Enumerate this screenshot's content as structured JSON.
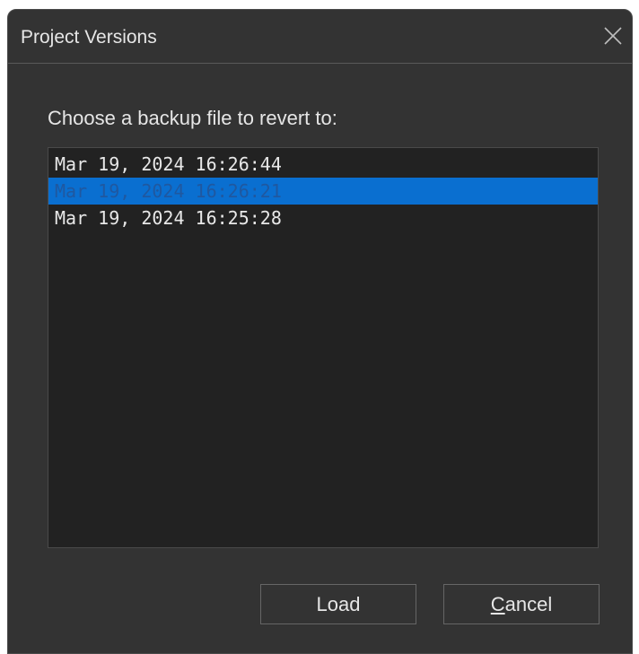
{
  "dialog": {
    "title": "Project Versions",
    "close_icon": "close-icon",
    "prompt": "Choose a backup file to revert to:",
    "versions": [
      "Mar 19, 2024 16:26:44",
      "Mar 19, 2024 16:26:21",
      "Mar 19, 2024 16:25:28"
    ],
    "selected_index": 1,
    "buttons": {
      "load": "Load",
      "cancel_accel": "C",
      "cancel_rest": "ancel"
    }
  },
  "colors": {
    "dialog_bg": "#333333",
    "list_bg": "#222222",
    "selection_bg": "#0a6fd0",
    "text": "#e6e6e6"
  }
}
